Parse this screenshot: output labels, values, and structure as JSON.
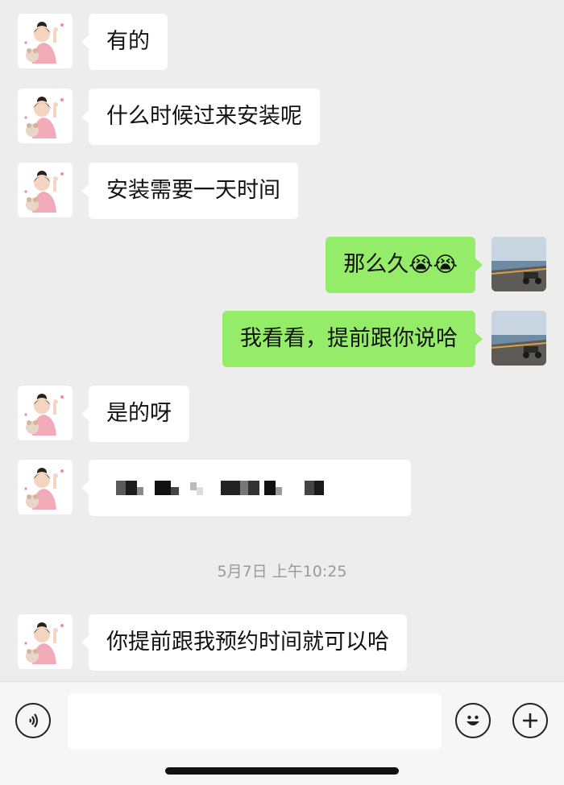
{
  "messages": [
    {
      "side": "left",
      "text": "有的"
    },
    {
      "side": "left",
      "text": "什么时候过来安装呢"
    },
    {
      "side": "left",
      "text": "安装需要一天时间"
    },
    {
      "side": "right",
      "text": "那么久",
      "emoji": "😭😭"
    },
    {
      "side": "right",
      "text": "我看看，提前跟你说哈"
    },
    {
      "side": "left",
      "text": "是的呀"
    },
    {
      "side": "left",
      "text": "",
      "redacted": true
    },
    {
      "side": "left",
      "text": "你提前跟我预约时间就可以哈"
    }
  ],
  "timestamp": "5月7日 上午10:25",
  "input": {
    "value": "",
    "placeholder": ""
  },
  "icons": {
    "voice": "voice-icon",
    "emoji": "emoji-icon",
    "plus": "plus-icon"
  },
  "colors": {
    "background": "#ededed",
    "incoming_bubble": "#ffffff",
    "outgoing_bubble": "#95ec69"
  }
}
